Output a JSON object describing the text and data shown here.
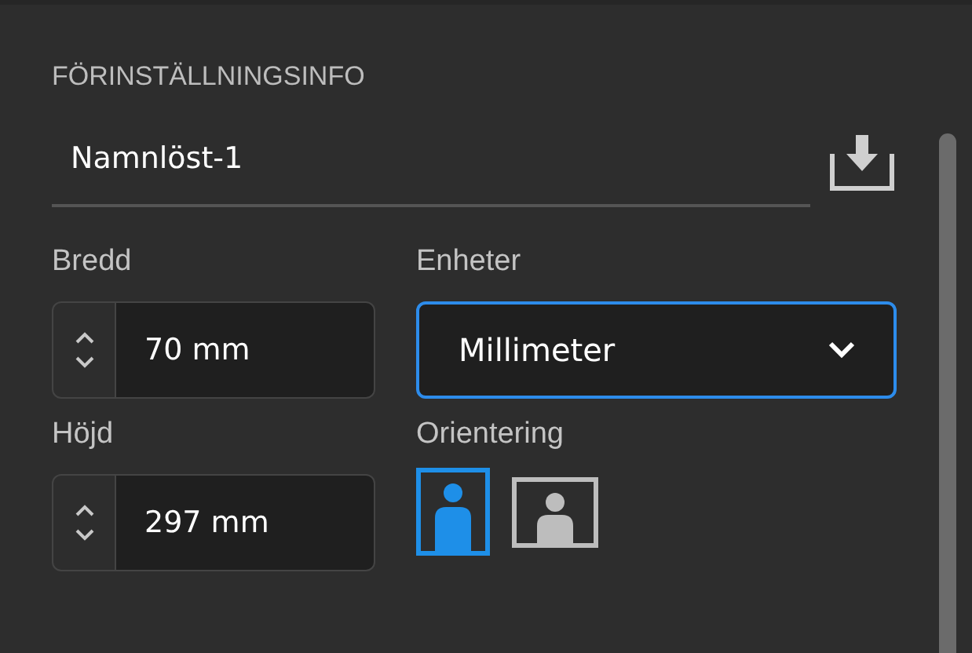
{
  "section_title": "FÖRINSTÄLLNINGSINFO",
  "preset_name": "Namnlöst-1",
  "width": {
    "label": "Bredd",
    "value": "70 mm"
  },
  "units": {
    "label": "Enheter",
    "value": "Millimeter"
  },
  "height": {
    "label": "Höjd",
    "value": "297 mm"
  },
  "orientation": {
    "label": "Orientering",
    "options": [
      {
        "kind": "portrait",
        "selected": true
      },
      {
        "kind": "landscape",
        "selected": false
      }
    ]
  }
}
